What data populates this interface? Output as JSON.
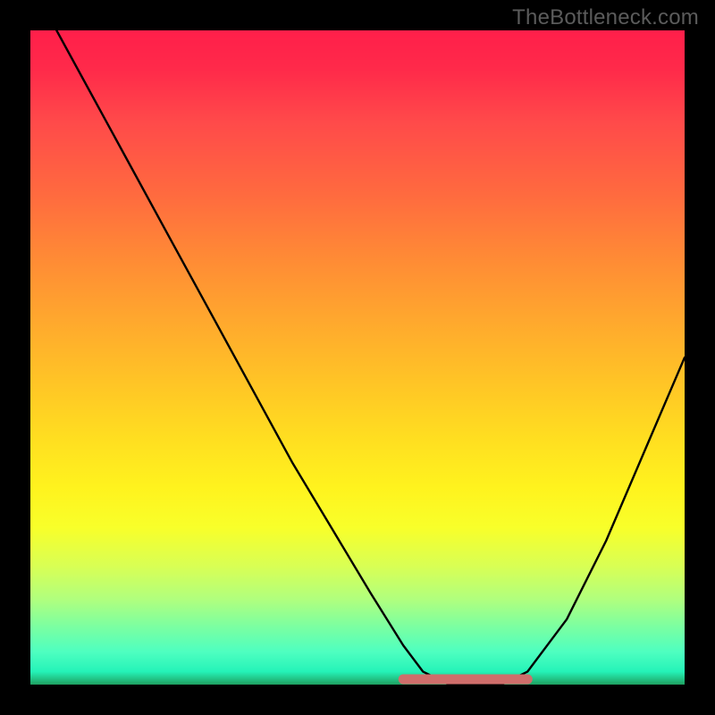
{
  "watermark": "TheBottleneck.com",
  "chart_data": {
    "type": "line",
    "title": "",
    "xlabel": "",
    "ylabel": "",
    "xlim": [
      0,
      100
    ],
    "ylim": [
      0,
      100
    ],
    "grid": false,
    "legend": false,
    "notes": "Axes unlabeled; values estimated from pixel positions; y=0 at bottom, y=100 at top.",
    "series": [
      {
        "name": "bottleneck-curve",
        "x": [
          4,
          10,
          16,
          22,
          28,
          34,
          40,
          46,
          52,
          57,
          60,
          64,
          68,
          72,
          76,
          82,
          88,
          94,
          100
        ],
        "y": [
          100,
          89,
          78,
          67,
          56,
          45,
          34,
          24,
          14,
          6,
          2,
          0,
          0,
          0,
          2,
          10,
          22,
          36,
          50
        ]
      }
    ],
    "annotations": [
      {
        "name": "optimal-range-band",
        "type": "segment",
        "x_start": 57,
        "x_end": 76,
        "y": 0,
        "color": "#cf6e6b"
      }
    ],
    "background_gradient": {
      "top_color": "#ff1f4a",
      "bottom_color": "#1fa060",
      "direction": "vertical"
    }
  }
}
